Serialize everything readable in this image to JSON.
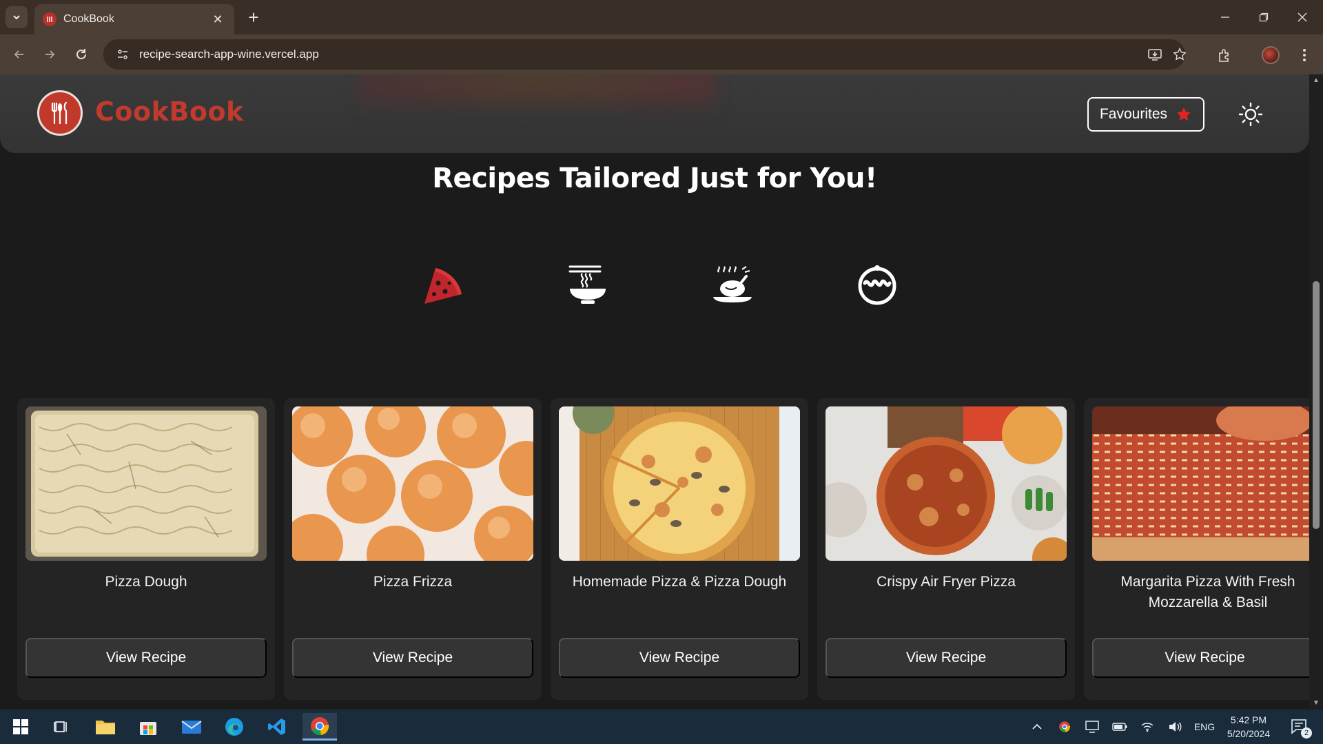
{
  "browser": {
    "tab_title": "CookBook",
    "url": "recipe-search-app-wine.vercel.app"
  },
  "header": {
    "logo_text": "CookBook",
    "favourites_label": "Favourites"
  },
  "main": {
    "heading": "Recipes Tailored Just for You!",
    "categories": [
      {
        "icon": "pizza-icon",
        "active": true
      },
      {
        "icon": "noodle-bowl-icon",
        "active": false
      },
      {
        "icon": "roast-chicken-icon",
        "active": false
      },
      {
        "icon": "dessert-icon",
        "active": false
      }
    ],
    "cards": [
      {
        "title": "Pizza Dough",
        "button": "View Recipe"
      },
      {
        "title": "Pizza Frizza",
        "button": "View Recipe"
      },
      {
        "title": "Homemade Pizza & Pizza Dough",
        "button": "View Recipe"
      },
      {
        "title": "Crispy Air Fryer Pizza",
        "button": "View Recipe"
      },
      {
        "title": "Margarita Pizza With Fresh Mozzarella & Basil",
        "button": "View Recipe"
      }
    ]
  },
  "taskbar": {
    "language": "ENG",
    "time": "5:42 PM",
    "date": "5/20/2024",
    "notification_count": "2"
  },
  "colors": {
    "accent_red": "#c23a2e",
    "page_bg": "#1b1b1b",
    "card_bg": "#242424",
    "button_bg": "#343434"
  }
}
